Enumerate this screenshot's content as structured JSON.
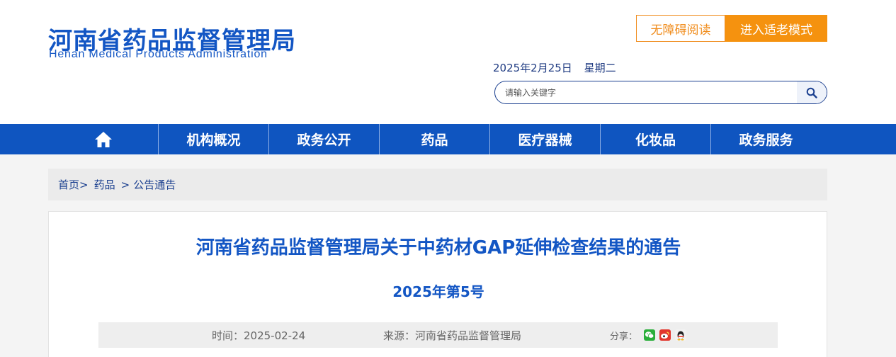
{
  "header": {
    "logo_cn": "河南省药品监督管理局",
    "logo_en": "Henan Medical Products Administration",
    "accessibility_label": "无障碍阅读",
    "elder_mode_label": "进入适老模式",
    "date": "2025年2月25日",
    "weekday": "星期二",
    "search": {
      "placeholder": "请输入关键字",
      "icon": "search-icon"
    }
  },
  "nav": {
    "home_icon": "home-icon",
    "items": [
      {
        "label": "机构概况"
      },
      {
        "label": "政务公开"
      },
      {
        "label": "药品"
      },
      {
        "label": "医疗器械"
      },
      {
        "label": "化妆品"
      },
      {
        "label": "政务服务"
      }
    ]
  },
  "breadcrumb": {
    "items": [
      "首页",
      "药品",
      "公告通告"
    ],
    "separator": ">"
  },
  "article": {
    "title": "河南省药品监督管理局关于中药材GAP延伸检查结果的通告",
    "subtitle": "2025年第5号",
    "time_label": "时间：2025-02-24",
    "source_label": "来源：河南省药品监督管理局",
    "share_label": "分享：",
    "share_icons": [
      "wechat-icon",
      "weibo-icon",
      "qq-icon"
    ]
  },
  "colors": {
    "brand_blue": "#1356c4",
    "nav_blue": "#0f55c0",
    "accent_orange": "#f5920f"
  }
}
